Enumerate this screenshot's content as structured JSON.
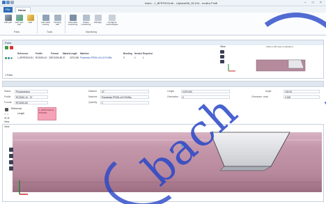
{
  "window": {
    "title": "Index - 1_BFRF0011db - Lilybead96_05.014 - evoltra Profil",
    "controls": [
      "–",
      "□",
      "×"
    ]
  },
  "tabs": {
    "file": "File",
    "home": "Home"
  },
  "ribbon": {
    "buttons": [
      {
        "label": "Add part",
        "icon": "add-part-icon"
      },
      {
        "label": "Add new part",
        "icon": "add-new-part-icon"
      },
      {
        "label": "Edit",
        "icon": "edit-icon"
      },
      {
        "label": "Automatic nesting",
        "icon": "auto-nesting-icon"
      },
      {
        "label": "Nesting with",
        "icon": "nesting-with-icon"
      },
      {
        "label": "Automatic machining",
        "icon": "auto-machining-icon"
      },
      {
        "label": "Delete machining",
        "icon": "delete-machining-icon"
      },
      {
        "label": "Manage",
        "icon": "manage-icon"
      },
      {
        "label": "Configure technologies",
        "icon": "configure-tech-icon"
      }
    ],
    "groups": [
      "Parts",
      "Tools",
      "Machining"
    ]
  },
  "parts_panel": {
    "title": "Parts",
    "columns": [
      "Reference",
      "Profile",
      "Format",
      "Material",
      "Length",
      "Machine",
      "Bending",
      "Nested",
      "Required"
    ],
    "rows": [
      {
        "reference": "1_BFRF0011G1",
        "profile": "RC5190-10 - 37",
        "format": "RC5190-80",
        "material": "37",
        "length": "2475.000",
        "machine": "Praxisinko PROfr-x24-24 Pcl36s",
        "bending": "0",
        "nested": "1",
        "required": "1"
      }
    ],
    "count": "1 Parts"
  },
  "view_panel": {
    "label": "View",
    "hint": "Click on 2D view to activate it"
  },
  "detail": {
    "status_label": "Status",
    "status_value": "Programming",
    "profile_label": "Profile",
    "profile_value": "RC5190-10 - 37",
    "format_label": "Format",
    "format_value": "RC5190-80",
    "material_label": "Material",
    "material_value": "37",
    "machine_label": "Machine",
    "machine_value": "Praxisinko PROfr-x24 Pcl36s",
    "quantity_label": "Quantity",
    "quantity_value": "1",
    "length_label": "Length",
    "length_value": "2475.000",
    "orientation_label": "Orientation",
    "orientation_value": "0",
    "angle_label": "Angle",
    "angle_value": "100.00",
    "clearance_label": "Clearance, track",
    "clearance_value": "2.000",
    "reference_label": "Reference",
    "reference_value": "1_BFRF0011G1",
    "ref_length_label": "Length",
    "ref_length_value": "RC5190-",
    "view_label": "View"
  },
  "watermark": "bach"
}
